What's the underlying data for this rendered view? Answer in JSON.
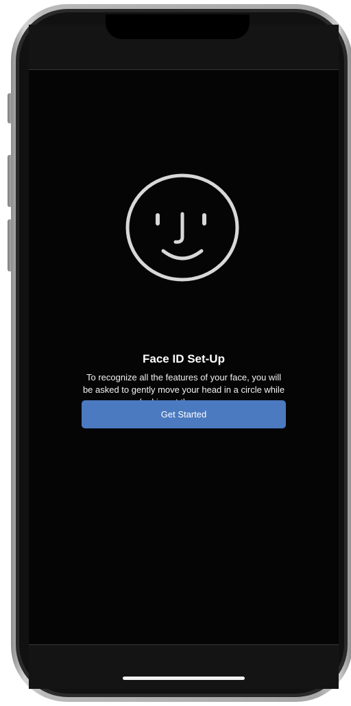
{
  "screen": {
    "title": "Face ID Set-Up",
    "description": "To recognize all the features of your face, you will be asked to gently move your head in a circle while looking at the camera.",
    "primary_button_label": "Get Started",
    "icon": "face-id-icon"
  },
  "colors": {
    "background": "#050505",
    "title_text": "#ffffff",
    "body_text": "#f2f2f2",
    "button_fill": "#4b7ac0",
    "icon_stroke": "#d8d8d8"
  }
}
